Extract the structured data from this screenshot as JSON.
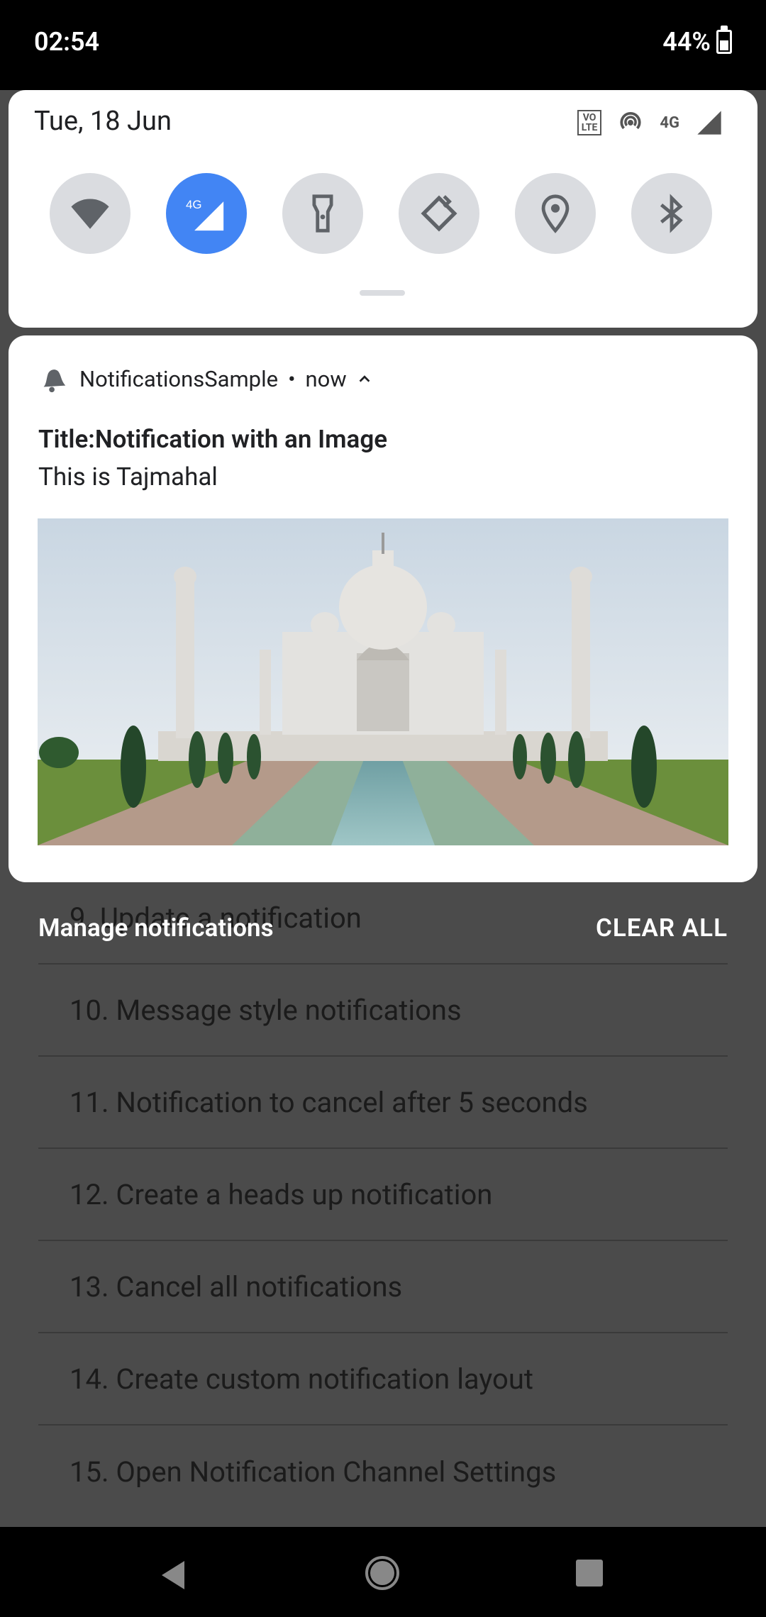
{
  "status_bar": {
    "time": "02:54",
    "battery_percent": "44%"
  },
  "quick_settings": {
    "date": "Tue, 18 Jun",
    "volte": "VO LTE",
    "network_type": "4G",
    "tiles": [
      {
        "name": "wifi-icon"
      },
      {
        "name": "mobile-data-icon",
        "label": "4G",
        "active": true
      },
      {
        "name": "flashlight-icon"
      },
      {
        "name": "auto-rotate-icon"
      },
      {
        "name": "location-icon"
      },
      {
        "name": "bluetooth-icon"
      }
    ]
  },
  "notification": {
    "app_name": "NotificationsSample",
    "separator": "•",
    "time": "now",
    "title": "Title:Notification with an Image",
    "text": "This is Tajmahal"
  },
  "shade_actions": {
    "manage": "Manage notifications",
    "clear_all": "CLEAR ALL"
  },
  "background_list": {
    "partial_item": "9. Update a notification",
    "items": [
      "10. Message style notifications",
      "11. Notification to cancel after 5 seconds",
      "12. Create a heads up notification",
      "13. Cancel all notifications",
      "14. Create custom notification layout",
      "15. Open Notification Channel Settings"
    ]
  },
  "colors": {
    "accent": "#4285f4",
    "scrim": "#4b4b4b",
    "tile_inactive": "#dadce0"
  }
}
